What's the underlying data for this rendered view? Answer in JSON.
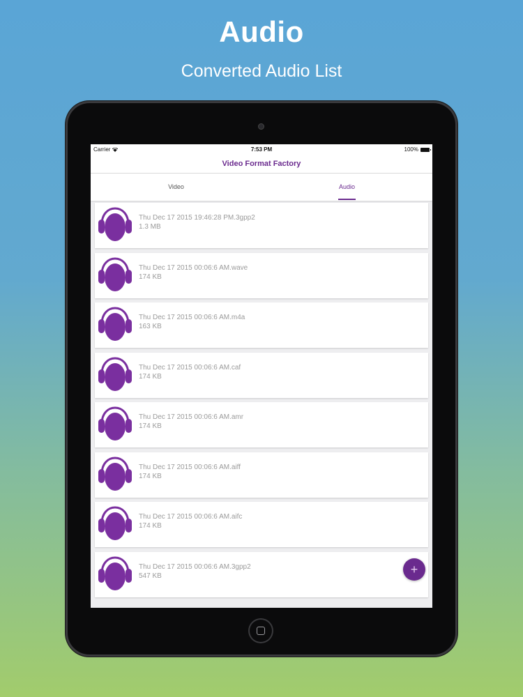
{
  "promo": {
    "title": "Audio",
    "subtitle": "Converted Audio List"
  },
  "status_bar": {
    "carrier": "Carrier",
    "time": "7:53 PM",
    "battery": "100%"
  },
  "nav": {
    "title": "Video Format Factory"
  },
  "tabs": [
    {
      "label": "Video",
      "selected": false
    },
    {
      "label": "Audio",
      "selected": true
    }
  ],
  "audio_list": [
    {
      "name": "Thu Dec 17 2015 19:46:28 PM.3gpp2",
      "size": "1.3 MB",
      "icon": "headphones-head-icon"
    },
    {
      "name": "Thu Dec 17 2015 00:06:6 AM.wave",
      "size": "174 KB",
      "icon": "headphones-head-icon"
    },
    {
      "name": "Thu Dec 17 2015 00:06:6 AM.m4a",
      "size": "163 KB",
      "icon": "headphones-head-icon"
    },
    {
      "name": "Thu Dec 17 2015 00:06:6 AM.caf",
      "size": "174 KB",
      "icon": "headphones-head-icon"
    },
    {
      "name": "Thu Dec 17 2015 00:06:6 AM.amr",
      "size": "174 KB",
      "icon": "headphones-head-icon"
    },
    {
      "name": "Thu Dec 17 2015 00:06:6 AM.aiff",
      "size": "174 KB",
      "icon": "headphones-head-icon"
    },
    {
      "name": "Thu Dec 17 2015 00:06:6 AM.aifc",
      "size": "174 KB",
      "icon": "headphones-head-icon"
    },
    {
      "name": "Thu Dec 17 2015 00:06:6 AM.3gpp2",
      "size": "547 KB",
      "icon": "headphones-head-icon"
    }
  ],
  "fab": {
    "icon": "plus-icon",
    "glyph": "+"
  },
  "colors": {
    "accent": "#6a2a8e",
    "bezel": "#0b0b0c"
  }
}
